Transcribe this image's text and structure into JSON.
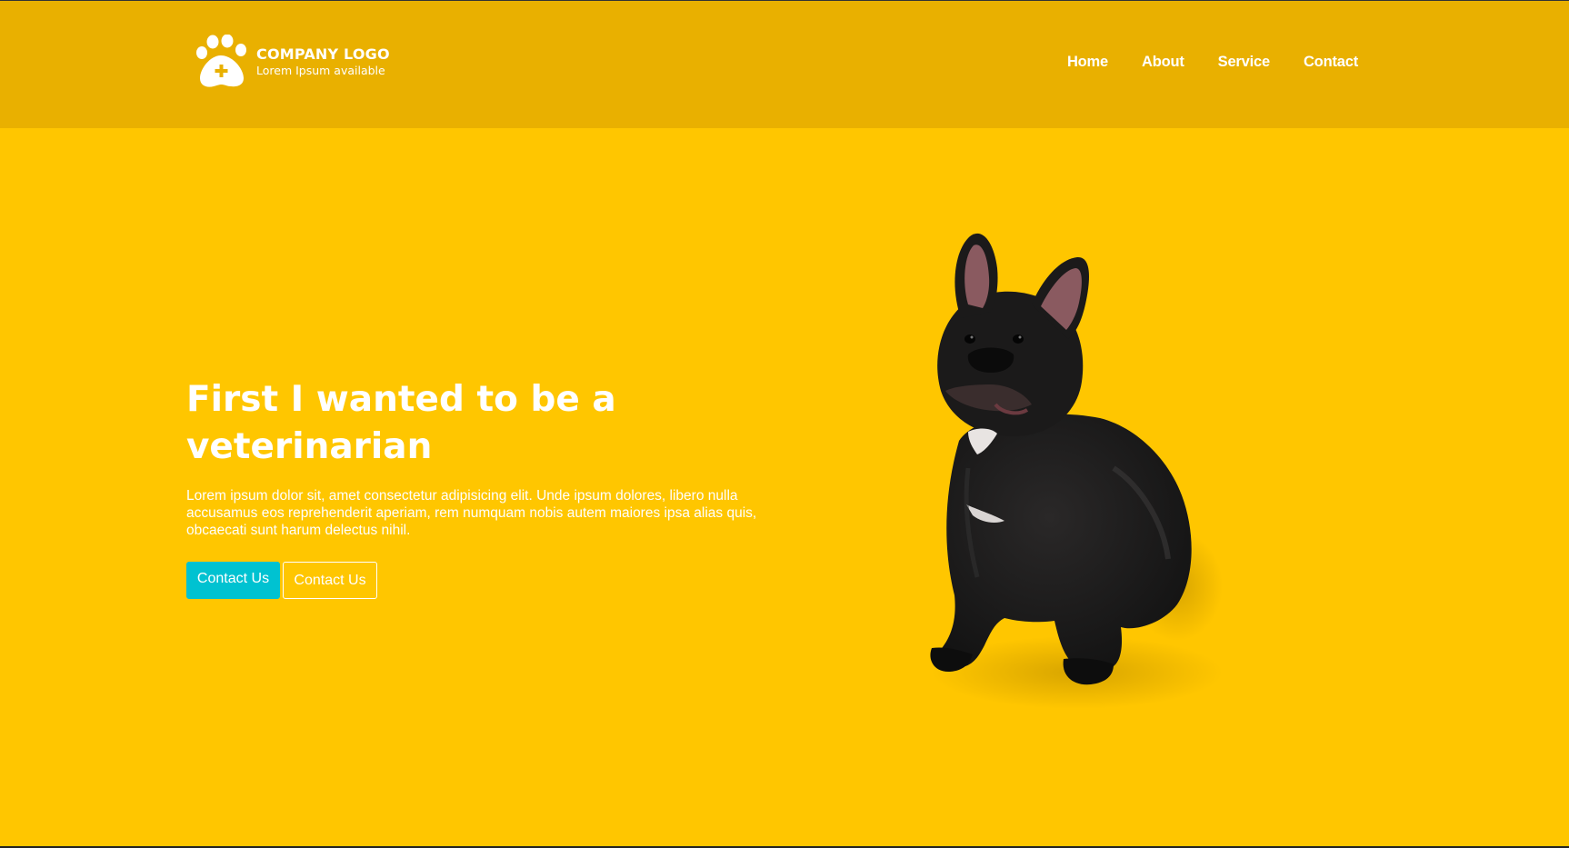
{
  "header": {
    "logo_title": "COMPANY LOGO",
    "logo_subtitle": "Lorem Ipsum available",
    "logo_icon": "paw-plus-icon",
    "nav": [
      {
        "label": "Home"
      },
      {
        "label": "About"
      },
      {
        "label": "Service"
      },
      {
        "label": "Contact"
      }
    ]
  },
  "hero": {
    "title": "First I wanted to be a veterinarian",
    "text": "Lorem ipsum dolor sit, amet consectetur adipisicing elit. Unde ipsum dolores, libero nulla accusamus eos reprehenderit aperiam, rem numquam nobis autem maiores ipsa alias quis, obcaecati sunt harum delectus nihil.",
    "primary_button": "Contact Us",
    "secondary_button": "Contact Us"
  },
  "colors": {
    "background": "#ffc600",
    "header": "#e9b000",
    "primary_button": "#00c2d1",
    "text": "#ffffff"
  }
}
